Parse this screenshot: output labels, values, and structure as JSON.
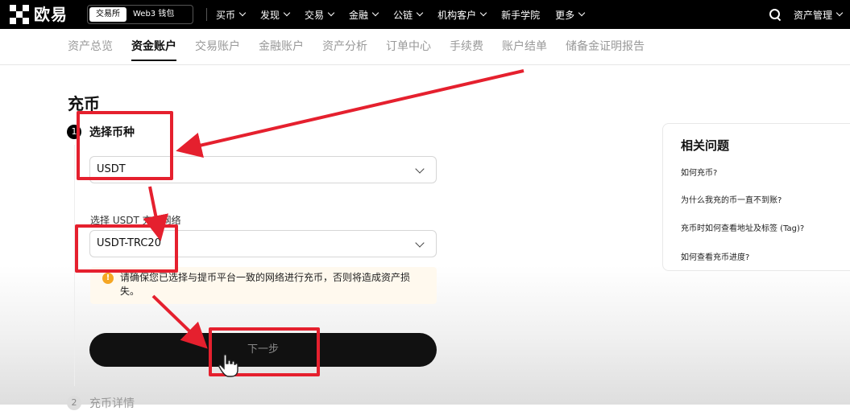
{
  "brand": {
    "name": "欧易"
  },
  "switcher": {
    "exchange": "交易所",
    "wallet": "Web3 钱包"
  },
  "nav": [
    {
      "label": "买币",
      "has_dropdown": true
    },
    {
      "label": "发现",
      "has_dropdown": true
    },
    {
      "label": "交易",
      "has_dropdown": true
    },
    {
      "label": "金融",
      "has_dropdown": true
    },
    {
      "label": "公链",
      "has_dropdown": true
    },
    {
      "label": "机构客户",
      "has_dropdown": true
    },
    {
      "label": "新手学院",
      "has_dropdown": false
    },
    {
      "label": "更多",
      "has_dropdown": true
    }
  ],
  "top_right": {
    "asset_management": "资产管理"
  },
  "subnav": {
    "tabs": [
      "资产总览",
      "资金账户",
      "交易账户",
      "金融账户",
      "资产分析",
      "订单中心",
      "手续费",
      "账户结单",
      "储备金证明报告"
    ],
    "active_index": 1
  },
  "deposit": {
    "title": "充币",
    "step1": {
      "number": "1",
      "label": "选择币种"
    },
    "coin_select": {
      "value": "USDT"
    },
    "network_label": "选择 USDT 充币网络",
    "network_select": {
      "value": "USDT-TRC20"
    },
    "warning": {
      "icon": "!",
      "text": "请确保您已选择与提币平台一致的网络进行充币，否则将造成资产损失。"
    },
    "next_button": "下一步",
    "step2": {
      "number": "2",
      "label": "充币详情"
    }
  },
  "related": {
    "title": "相关问题",
    "links": [
      "如何充币?",
      "为什么我充的币一直不到账?",
      "充币时如何查看地址及标签 (Tag)?",
      "如何查看充币进度?"
    ]
  },
  "colors": {
    "annotation_red": "#e5202e",
    "warning_orange": "#f5a623",
    "topbar_bg": "#000000",
    "button_bg": "#111111"
  }
}
